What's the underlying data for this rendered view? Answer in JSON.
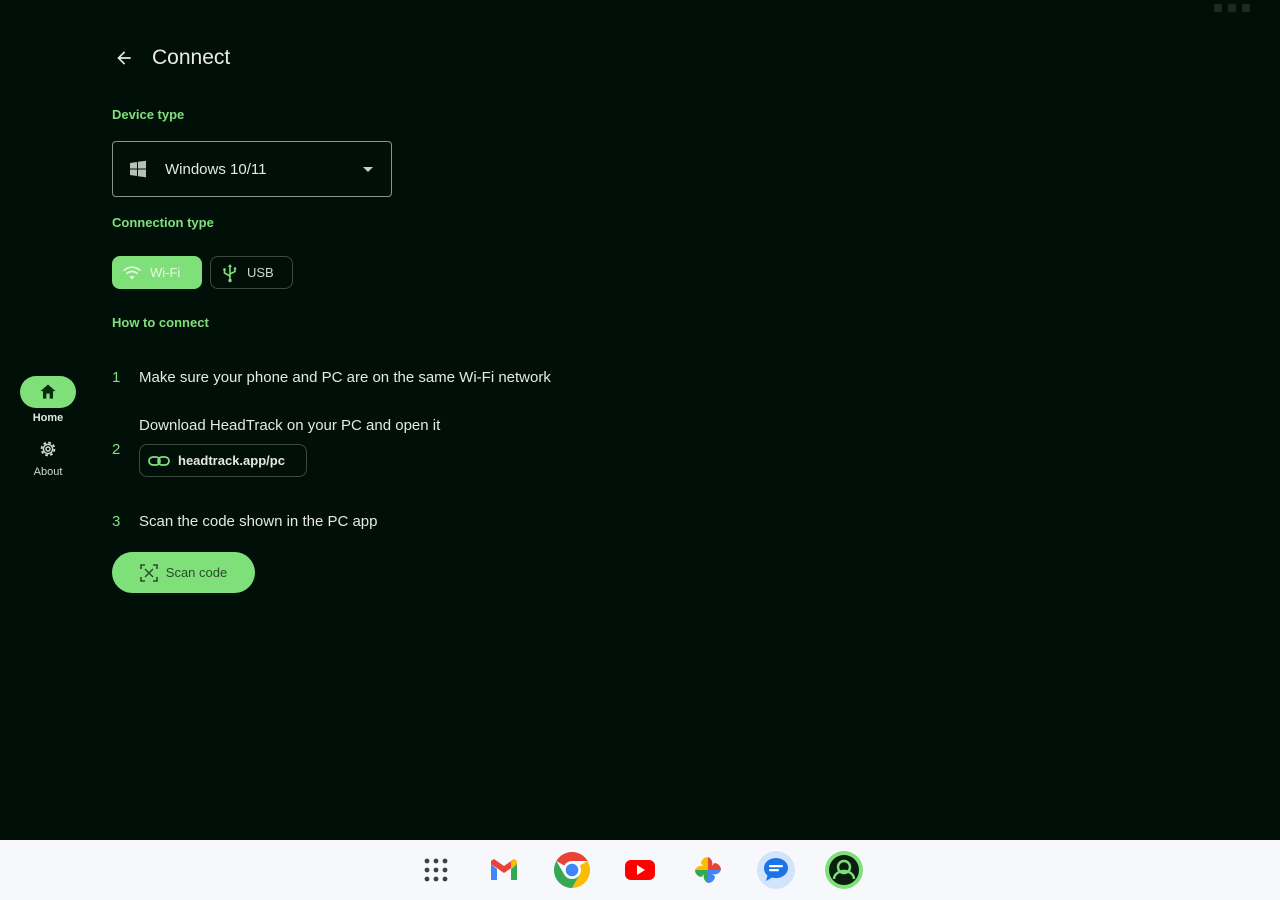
{
  "header": {
    "title": "Connect",
    "back_icon": "arrow-back-icon"
  },
  "nav": {
    "home_label": "Home",
    "about_label": "About"
  },
  "device": {
    "section_label": "Device type",
    "selected": "Windows 10/11"
  },
  "connection": {
    "section_label": "Connection type",
    "wifi_label": "Wi-Fi",
    "usb_label": "USB",
    "selected": "Wi-Fi"
  },
  "how_to": {
    "section_label": "How to connect",
    "steps": [
      {
        "num": "1",
        "text": "Make sure your phone and PC are on the same Wi-Fi network"
      },
      {
        "num": "2",
        "text": "Download HeadTrack on your PC and open it"
      },
      {
        "num": "3",
        "text": "Scan the code shown in the PC app"
      }
    ],
    "link": "headtrack.app/pc",
    "scan_button": "Scan code"
  },
  "taskbar": {
    "apps": [
      "app-launcher-icon",
      "gmail-icon",
      "chrome-icon",
      "youtube-icon",
      "photos-icon",
      "messages-icon",
      "headtrack-icon"
    ]
  },
  "colors": {
    "background": "#000f08",
    "accent": "#7fe07a",
    "text": "#e6e8e2",
    "taskbar": "#f7f8fc"
  }
}
